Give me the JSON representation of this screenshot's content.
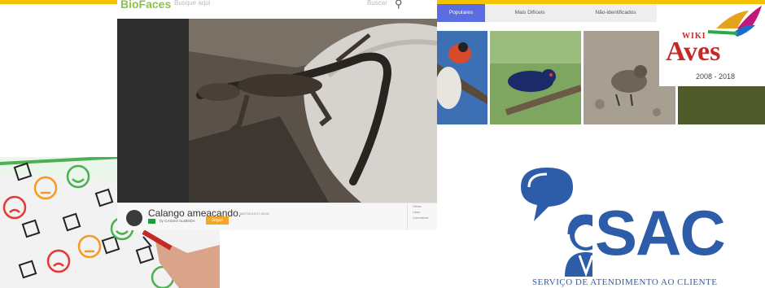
{
  "colors": {
    "topbar": "#f3c300",
    "bio_green": "#8bc34a",
    "tab_active": "#5b6de0",
    "wiki_red": "#c62828",
    "sac_blue": "#2d5ca8",
    "follow_orange": "#f5a623"
  },
  "biofaces": {
    "logo": "BioFaces",
    "search_placeholder": "Busque aqui",
    "search_button": "Buscar",
    "search_icon": "search-icon",
    "post": {
      "title": "Calango ameaçando.",
      "date": "18/07/2015 07:23:00",
      "author": "by CASSIO ALMEIDA",
      "follow_label": "Seguir",
      "stats": [
        "Views",
        "Likes",
        "Comments"
      ]
    }
  },
  "wikiaves": {
    "tabs": [
      {
        "label": "Populares",
        "active": true
      },
      {
        "label": "Mais Difíceis",
        "active": false
      },
      {
        "label": "Não-identificados",
        "active": false
      }
    ],
    "logo": {
      "wiki": "WIKI",
      "aves": "Aves",
      "years": "2008 - 2018"
    }
  },
  "sac": {
    "title": "SAC",
    "caption": "SERVIÇO DE ATENDIMENTO AO CLIENTE"
  }
}
